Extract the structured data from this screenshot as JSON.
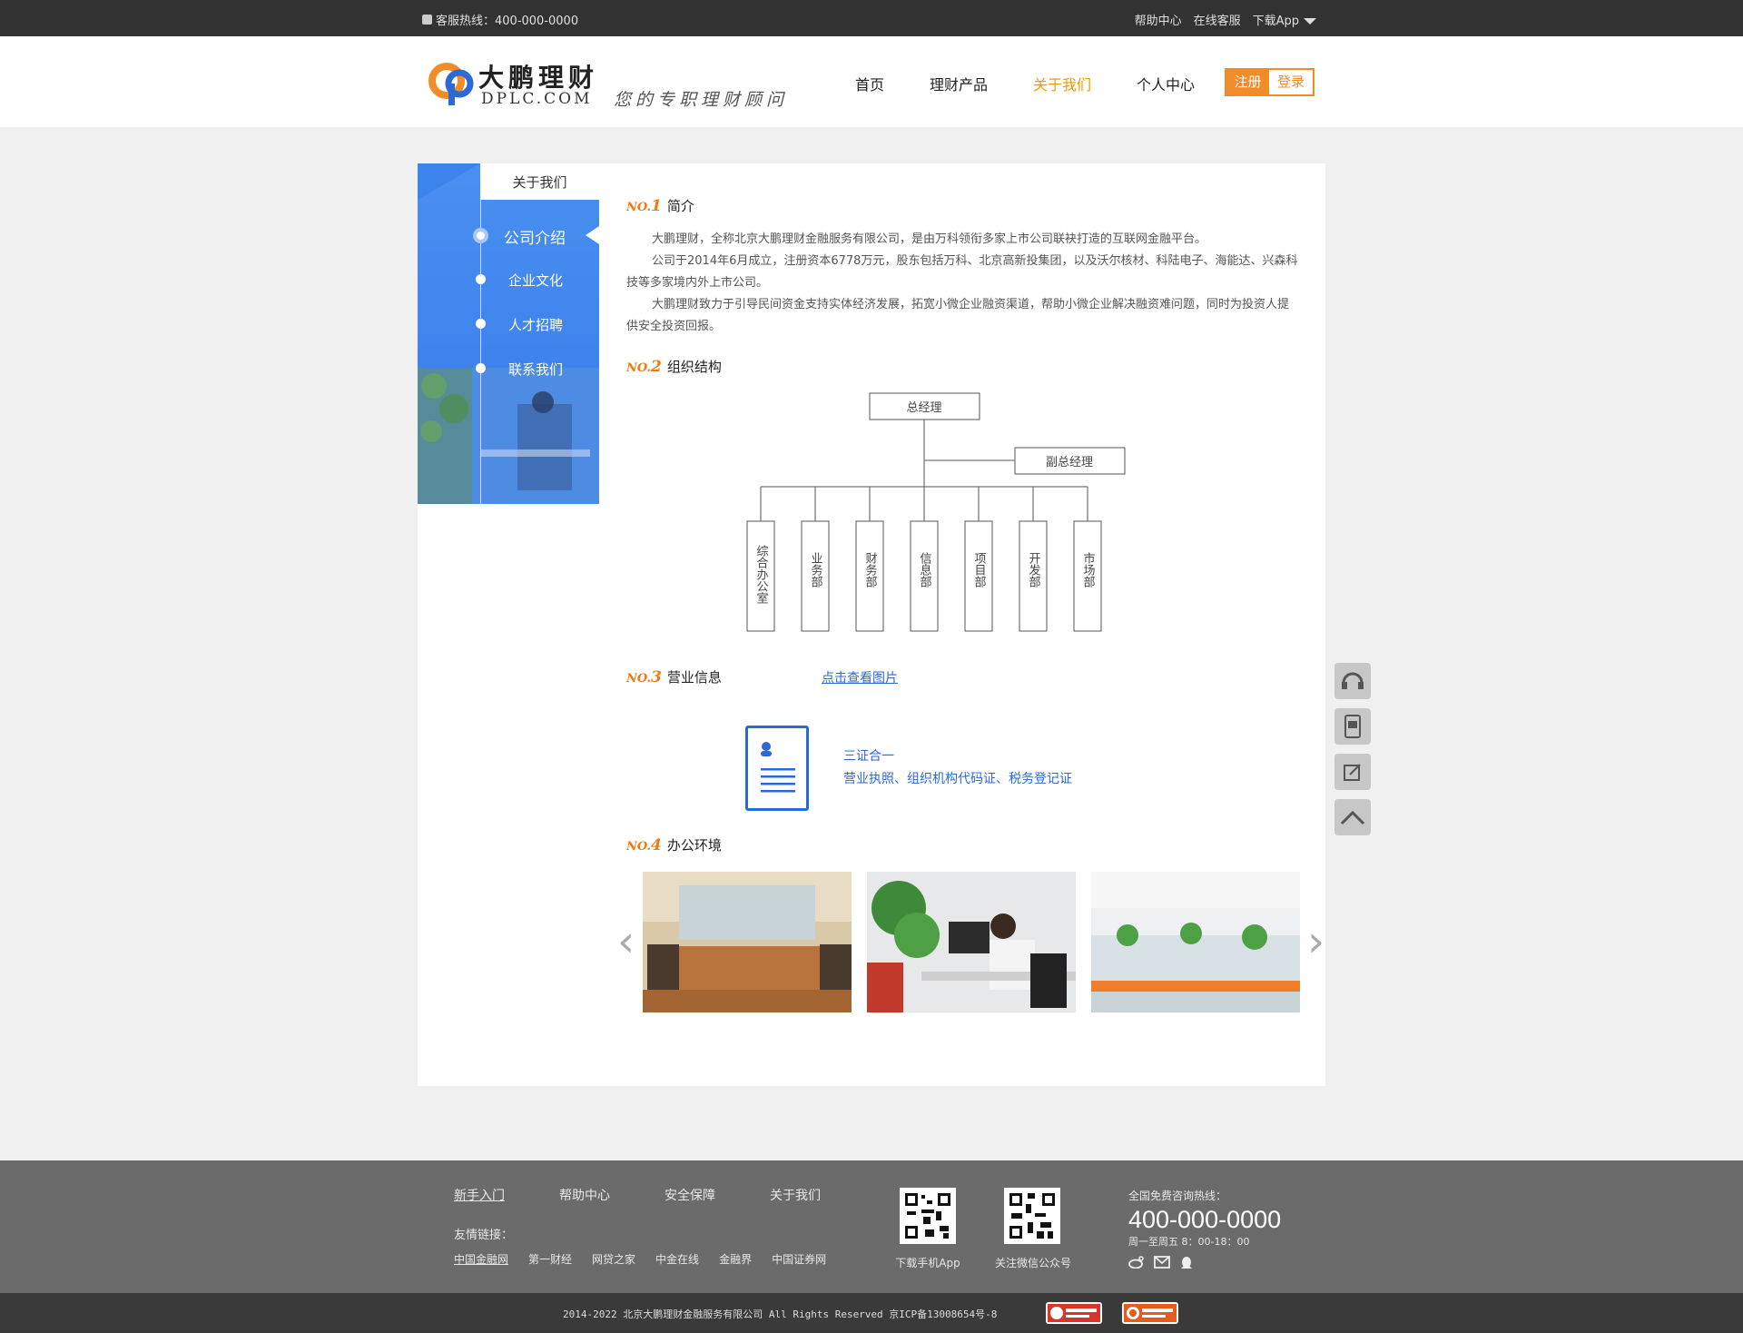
{
  "topbar": {
    "hotline": "客服热线：400-000-0000",
    "help": "帮助中心",
    "online": "在线客服",
    "download": "下载App"
  },
  "header": {
    "brand": "大鹏理财",
    "domain": "DPLC.COM",
    "slogan": "您的专职理财顾问",
    "nav": [
      "首页",
      "理财产品",
      "关于我们",
      "个人中心"
    ],
    "active_nav": "关于我们",
    "register": "注册",
    "login": "登录"
  },
  "side": {
    "title": "关于我们",
    "items": [
      "公司介绍",
      "企业文化",
      "人才招聘",
      "联系我们"
    ],
    "current": "公司介绍"
  },
  "sections": {
    "no1": {
      "no": "NO.",
      "num": "1",
      "title": "简介",
      "paragraphs": [
        "大鹏理财，全称北京大鹏理财金融服务有限公司，是由万科领衔多家上市公司联袂打造的互联网金融平台。",
        "公司于2014年6月成立，注册资本6778万元，股东包括万科、北京高新投集团，以及沃尔核材、科陆电子、海能达、兴森科技等多家境内外上市公司。",
        "大鹏理财致力于引导民间资金支持实体经济发展，拓宽小微企业融资渠道，帮助小微企业解决融资难问题，同时为投资人提供安全投资回报。"
      ]
    },
    "no2": {
      "no": "NO.",
      "num": "2",
      "title": "组织结构",
      "top": "总经理",
      "deputy": "副总经理",
      "departments": [
        "综合办公室",
        "业务部",
        "财务部",
        "信息部",
        "项目部",
        "开发部",
        "市场部"
      ]
    },
    "no3": {
      "no": "NO.",
      "num": "3",
      "title": "营业信息",
      "link": "点击查看图片",
      "cert_title": "三证合一",
      "cert_desc": "营业执照、组织机构代码证、税务登记证"
    },
    "no4": {
      "no": "NO.",
      "num": "4",
      "title": "办公环境"
    }
  },
  "footer": {
    "links": [
      "新手入门",
      "帮助中心",
      "安全保障",
      "关于我们"
    ],
    "friend_label": "友情链接：",
    "friends": [
      "中国金融网",
      "第一财经",
      "网贷之家",
      "中金在线",
      "金融界",
      "中国证券网"
    ],
    "qr_app": "下载手机App",
    "qr_wechat": "关注微信公众号",
    "hotline_label": "全国免费咨询热线：",
    "hotline": "400-000-0000",
    "hours": "周一至周五 8：00-18：00"
  },
  "bottom": {
    "copyright": "2014-2022 北京大鹏理财金融服务有限公司 All Rights Reserved  京ICP备13008654号-8"
  },
  "colors": {
    "orange": "#f28c28",
    "blue": "#3d83ec",
    "link": "#2b6ad6",
    "topbar": "#323232",
    "footer": "#6b6b6b"
  }
}
